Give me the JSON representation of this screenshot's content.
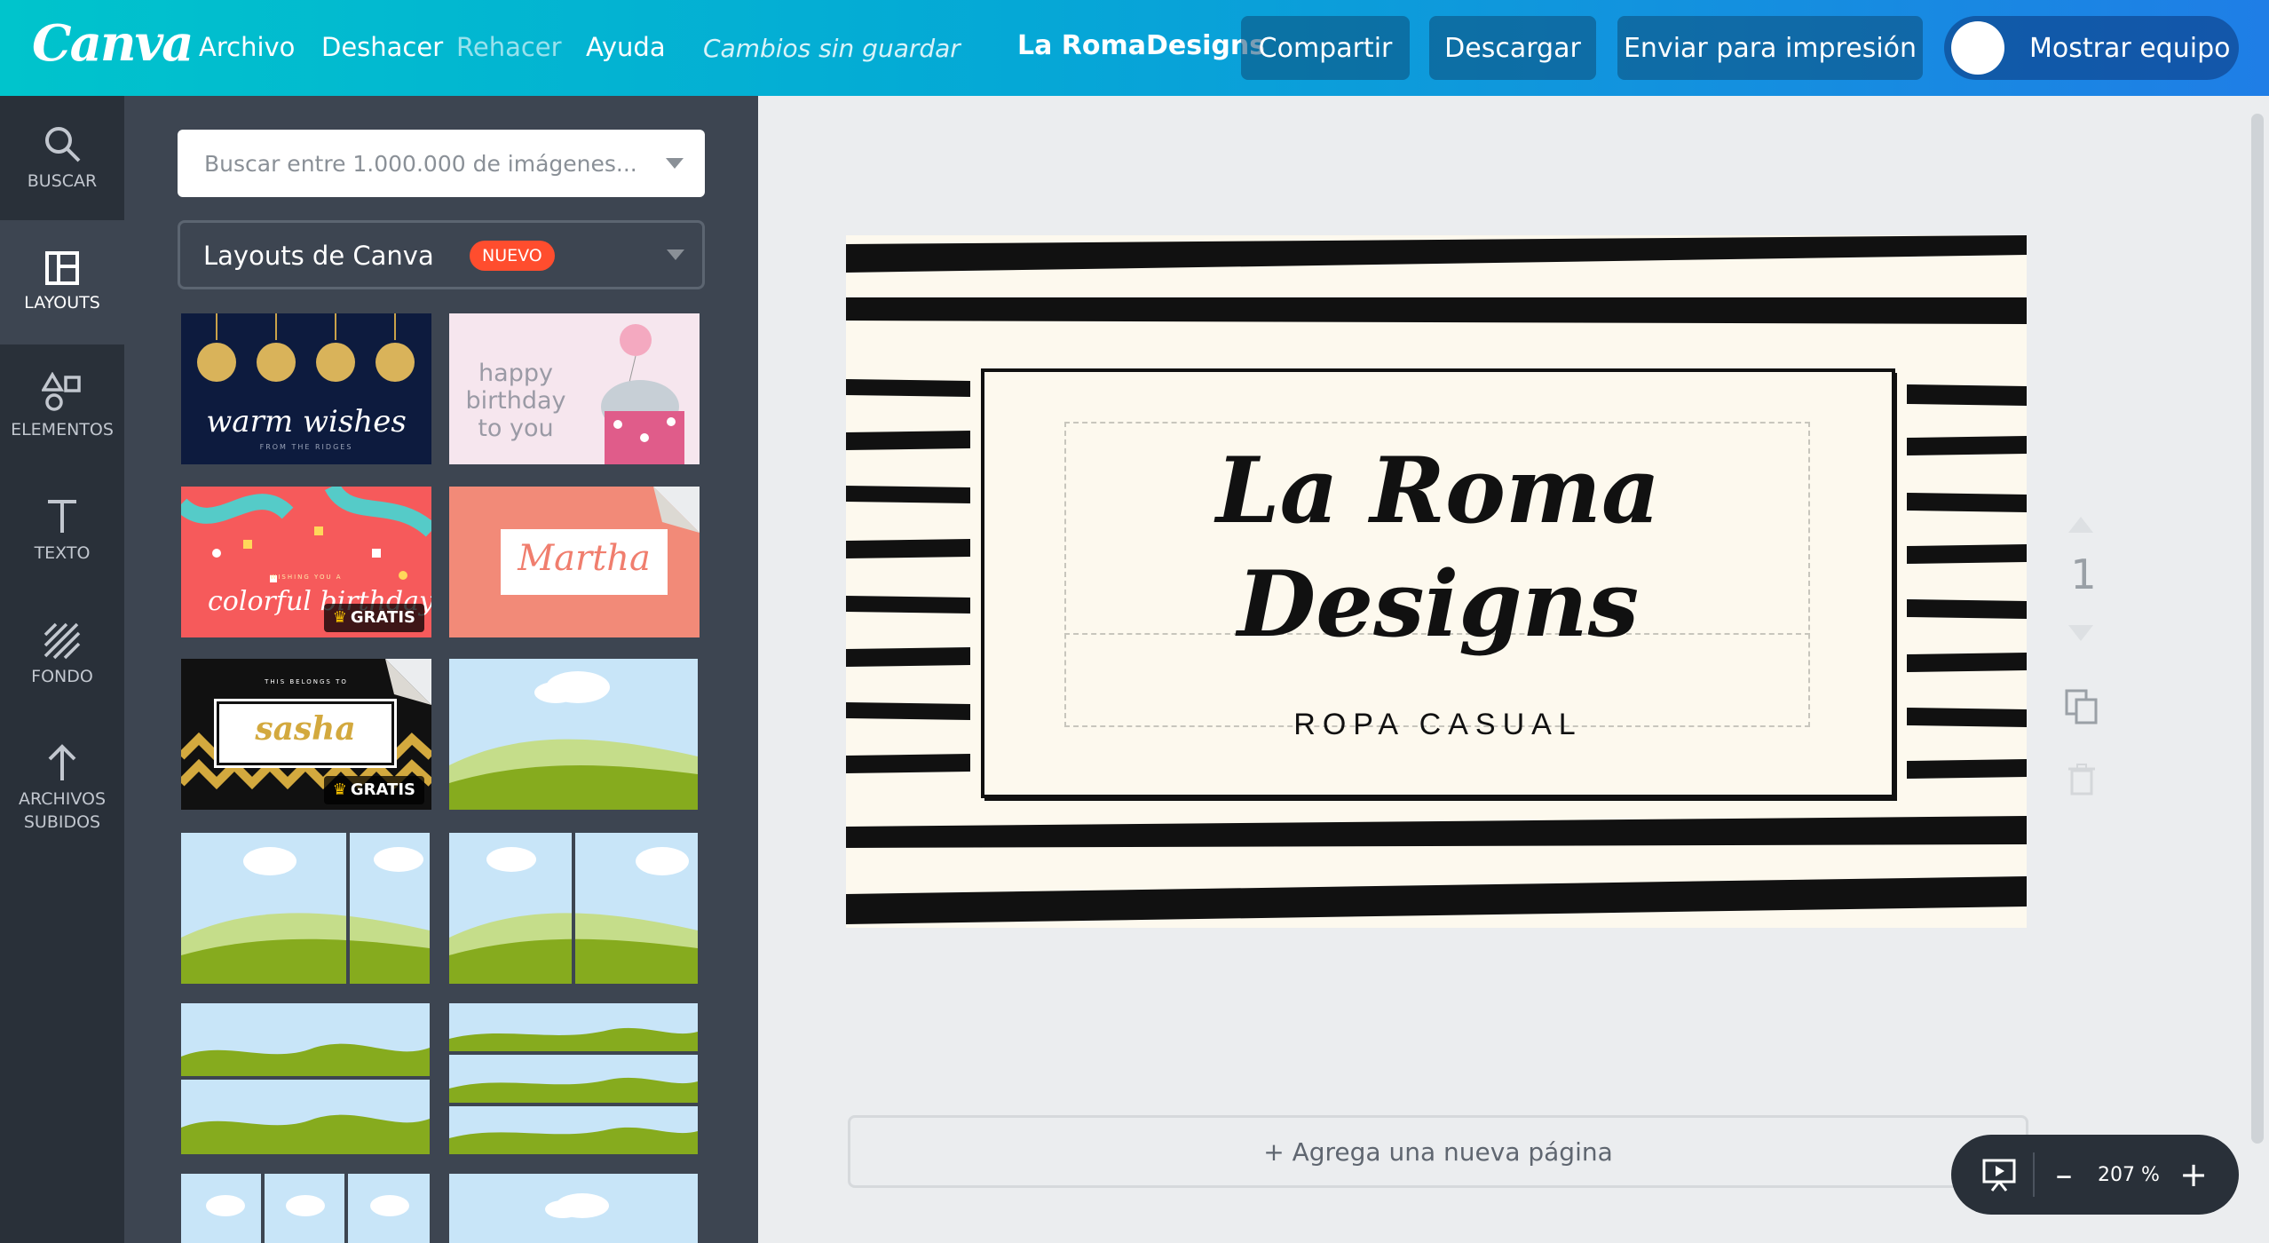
{
  "topbar": {
    "logo": "Canva",
    "menu": {
      "file": "Archivo",
      "undo": "Deshacer",
      "redo": "Rehacer",
      "help": "Ayuda"
    },
    "status": "Cambios sin guardar",
    "design_name": "La RomaDesigns",
    "share": "Compartir",
    "download": "Descargar",
    "print": "Enviar para impresión",
    "team": "Mostrar equipo"
  },
  "sidebar": {
    "items": [
      {
        "label": "BUSCAR",
        "icon": "search-icon"
      },
      {
        "label": "LAYOUTS",
        "icon": "layouts-icon",
        "active": true
      },
      {
        "label": "ELEMENTOS",
        "icon": "elements-icon"
      },
      {
        "label": "TEXTO",
        "icon": "text-icon"
      },
      {
        "label": "FONDO",
        "icon": "background-icon"
      },
      {
        "label": "ARCHIVOS",
        "label2": "SUBIDOS",
        "icon": "upload-icon"
      }
    ]
  },
  "panel": {
    "search_placeholder": "Buscar entre 1.000.000 de imágenes...",
    "layout_select": "Layouts de Canva",
    "new_badge": "NUEVO",
    "gratis": "GRATIS",
    "templates": {
      "warm_wishes": {
        "title": "warm wishes",
        "sub": "FROM THE RIDGES"
      },
      "birthday_pink": {
        "line1": "happy",
        "line2": "birthday",
        "line3": "to you"
      },
      "colorful": {
        "small": "WISHING YOU A",
        "title": "colorful birthday!"
      },
      "martha": {
        "title": "Martha"
      },
      "sasha": {
        "small": "THIS BELONGS TO",
        "title": "sasha"
      }
    }
  },
  "design": {
    "title_line1": "La Roma",
    "title_line2": "Designs",
    "subtitle": "ROPA CASUAL"
  },
  "page": {
    "number": "1",
    "add_page": "+ Agrega una nueva página"
  },
  "zoom": {
    "minus": "–",
    "value": "207 %",
    "plus": "+"
  },
  "colors": {
    "topbar_start": "#00c4cc",
    "topbar_end": "#1f7ee6",
    "rail": "#293039",
    "panel": "#3d4551",
    "badge": "#ff4d2e",
    "design_bg": "#fdf9ee"
  }
}
